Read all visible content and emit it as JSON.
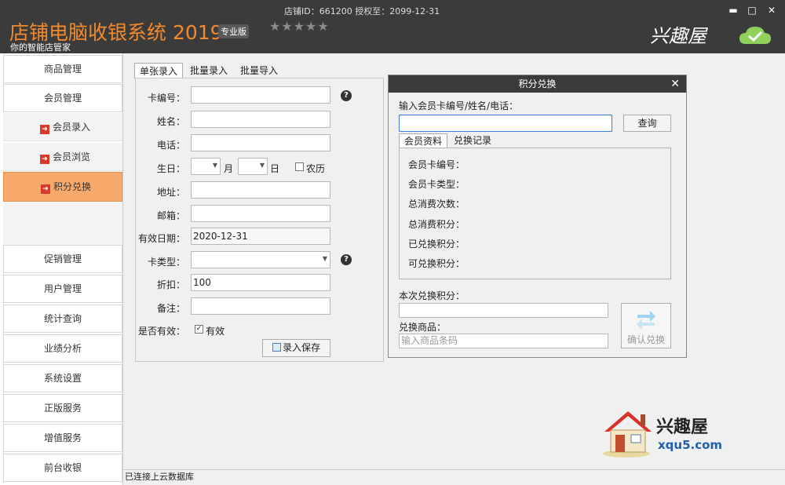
{
  "window": {
    "title": "店铺电脑收银系统 2019",
    "edition": "专业版",
    "tagline": "你的智能店管家",
    "store_info": "店铺ID：661200 授权至：2099-12-31",
    "stars": "★★★★★",
    "brand": "兴趣屋",
    "minimize": "▬",
    "maximize": "□",
    "close": "✕"
  },
  "sidebar": {
    "items": [
      {
        "label": "商品管理"
      },
      {
        "label": "会员管理"
      },
      {
        "label": "会员录入"
      },
      {
        "label": "会员浏览"
      },
      {
        "label": "积分兑换"
      },
      {
        "label": "促销管理"
      },
      {
        "label": "用户管理"
      },
      {
        "label": "统计查询"
      },
      {
        "label": "业绩分析"
      },
      {
        "label": "系统设置"
      },
      {
        "label": "正版服务"
      },
      {
        "label": "增值服务"
      },
      {
        "label": "前台收银"
      }
    ]
  },
  "tabs": [
    "单张录入",
    "批量录入",
    "批量导入"
  ],
  "form": {
    "card_no": "卡编号：",
    "name": "姓名：",
    "phone": "电话：",
    "birthday": "生日：",
    "month": "月",
    "day": "日",
    "lunar": "农历",
    "address": "地址：",
    "email": "邮箱：",
    "valid_date": "有效日期：",
    "valid_date_value": "2020-12-31",
    "card_type": "卡类型：",
    "discount": "折扣：",
    "discount_value": "100",
    "remark": "备注：",
    "is_valid": "是否有效：",
    "valid_check": "有效",
    "save_button": "录入保存",
    "help": "?"
  },
  "dialog": {
    "title": "积分兑换",
    "close": "✕",
    "search_label": "输入会员卡编号/姓名/电话：",
    "query_button": "查询",
    "tabs": [
      "会员资料",
      "兑换记录"
    ],
    "info": [
      "会员卡编号：",
      "会员卡类型：",
      "总消费次数：",
      "总消费积分：",
      "已兑换积分：",
      "可兑换积分："
    ],
    "points_label": "本次兑换积分：",
    "product_label": "兑换商品：",
    "product_placeholder": "输入商品条码",
    "confirm_button": "确认兑换"
  },
  "status": "已连接上云数据库",
  "watermark": {
    "name": "兴趣屋",
    "url": "xqu5.com"
  },
  "colors": {
    "accent": "#f28a2e",
    "active_nav": "#f6a96b",
    "titlebar": "#3b3b3b"
  }
}
